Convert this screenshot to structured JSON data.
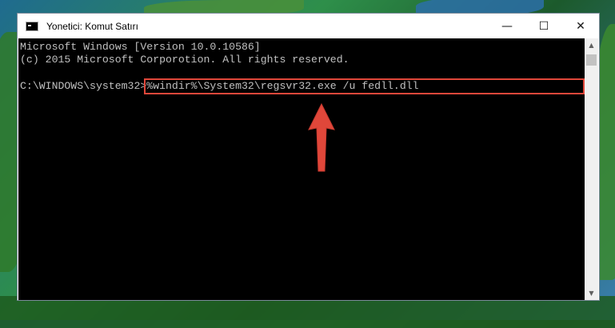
{
  "window": {
    "title": "Yonetici: Komut Satırı",
    "minimize_symbol": "—",
    "maximize_symbol": "☐",
    "close_symbol": "✕"
  },
  "console": {
    "lines": [
      "Microsoft Windows [Version 10.0.10586]",
      "(c) 2015 Microsoft Corporotion. All rights reserved.",
      ""
    ],
    "prompt": "C:\\WINDOWS\\system32>",
    "command": "%windir%\\System32\\regsvr32.exe /u fedll.dll"
  },
  "annotation": {
    "highlight_color": "#e0473a",
    "arrow_color": "#e0473a",
    "arrow_icon": "up-arrow-icon"
  },
  "scrollbar": {
    "up_symbol": "▲",
    "down_symbol": "▼"
  }
}
